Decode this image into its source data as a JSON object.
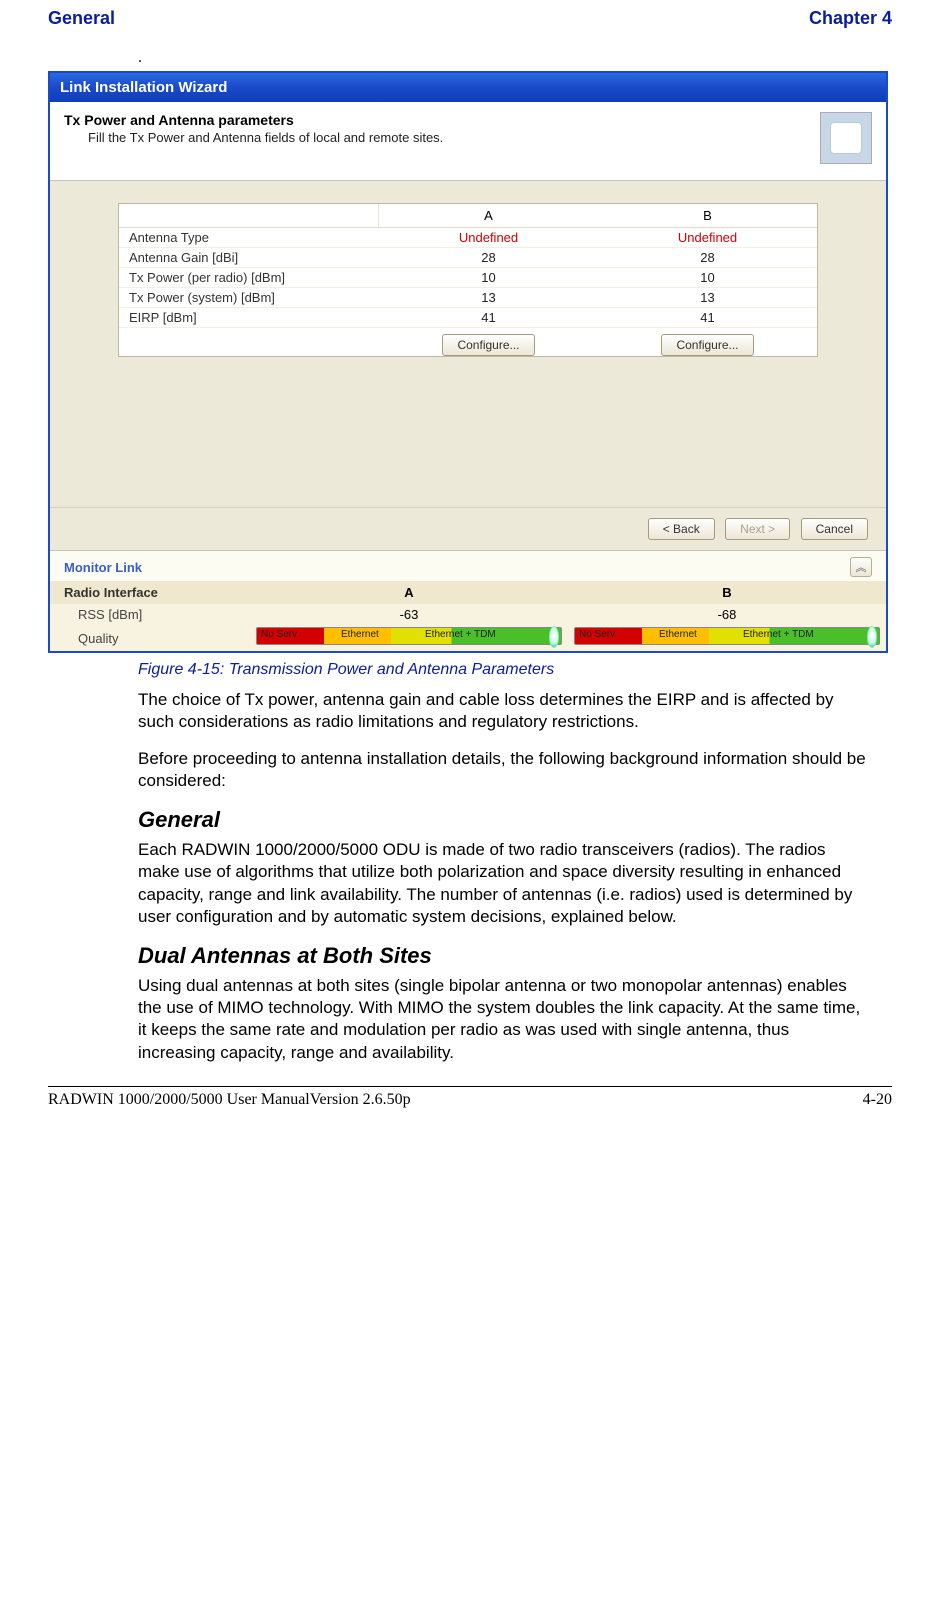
{
  "header": {
    "left": "General",
    "right": "Chapter 4"
  },
  "dot": ".",
  "wizard": {
    "title": "Link Installation Wizard",
    "hdr": {
      "title": "Tx Power and Antenna parameters",
      "sub": "Fill the Tx Power and Antenna fields of local and remote sites."
    },
    "cols": {
      "a": "A",
      "b": "B"
    },
    "rows": [
      {
        "label": "Antenna Type",
        "a": "Undefined",
        "b": "Undefined",
        "undef": true
      },
      {
        "label": "Antenna Gain [dBi]",
        "a": "28",
        "b": "28"
      },
      {
        "label": "Tx Power (per radio) [dBm]",
        "a": "10",
        "b": "10"
      },
      {
        "label": "Tx Power (system) [dBm]",
        "a": "13",
        "b": "13"
      },
      {
        "label": "EIRP [dBm]",
        "a": "41",
        "b": "41"
      }
    ],
    "configure_label": "Configure...",
    "nav": {
      "back": "< Back",
      "next": "Next >",
      "cancel": "Cancel"
    },
    "monitor": {
      "title": "Monitor Link",
      "chev": "︽"
    },
    "radio": {
      "label": "Radio Interface",
      "a": "A",
      "b": "B"
    },
    "rss": {
      "label": "RSS [dBm]",
      "a": "-63",
      "b": "-68"
    },
    "quality": {
      "label": "Quality",
      "seg": {
        "noserv": "No Serv",
        "eth": "Ethernet",
        "ethtdm": "Ethernet + TDM"
      }
    }
  },
  "caption": "Figure 4-15: Transmission Power and Antenna Parameters",
  "para1": "The choice of Tx power, antenna gain and cable loss determines the EIRP and is affected by such considerations as radio limitations and regulatory restrictions.",
  "para2": "Before proceeding to antenna installation details, the following background information should be considered:",
  "sec1": {
    "title": "General",
    "p": "Each RADWIN 1000/2000/5000 ODU is made of two radio transceivers (radios). The radios make use of algorithms that utilize both polarization and space diversity resulting in enhanced capacity, range and link availability. The number of antennas (i.e. radios) used is determined by user configuration and by automatic system decisions, explained below."
  },
  "sec2": {
    "title": "Dual Antennas at Both Sites",
    "p": "Using dual antennas at both sites (single bipolar antenna or two monopolar antennas) enables the use of MIMO technology. With MIMO the system doubles the link capacity. At the same time, it keeps the same rate and modulation per radio as was used with single antenna, thus increasing capacity, range and availability."
  },
  "footer": {
    "left": "RADWIN 1000/2000/5000 User ManualVersion  2.6.50p",
    "right": "4-20"
  }
}
